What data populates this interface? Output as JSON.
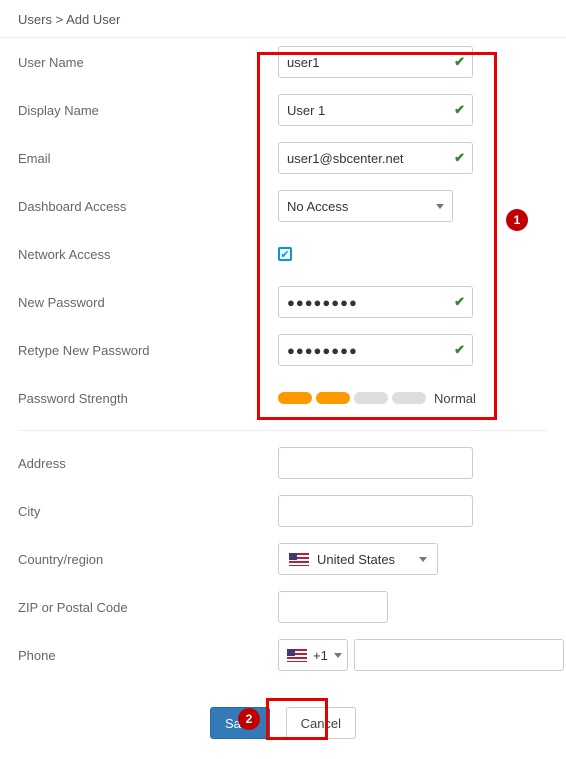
{
  "breadcrumb": {
    "parent": "Users",
    "sep": ">",
    "current": "Add User"
  },
  "callouts": {
    "one": "1",
    "two": "2"
  },
  "fields": {
    "username": {
      "label": "User Name",
      "value": "user1"
    },
    "display": {
      "label": "Display Name",
      "value": "User 1"
    },
    "email": {
      "label": "Email",
      "value": "user1@sbcenter.net"
    },
    "dashboard": {
      "label": "Dashboard Access",
      "value": "No Access"
    },
    "netaccess": {
      "label": "Network Access",
      "checked": true
    },
    "newpass": {
      "label": "New Password",
      "value": "●●●●●●●●"
    },
    "retype": {
      "label": "Retype New Password",
      "value": "●●●●●●●●"
    },
    "strength": {
      "label": "Password Strength",
      "level": 2,
      "text": "Normal"
    },
    "address": {
      "label": "Address",
      "value": ""
    },
    "city": {
      "label": "City",
      "value": ""
    },
    "country": {
      "label": "Country/region",
      "value": "United States"
    },
    "zip": {
      "label": "ZIP or Postal Code",
      "value": ""
    },
    "phone": {
      "label": "Phone",
      "code": "+1",
      "value": ""
    }
  },
  "buttons": {
    "save": "Save",
    "cancel": "Cancel"
  }
}
